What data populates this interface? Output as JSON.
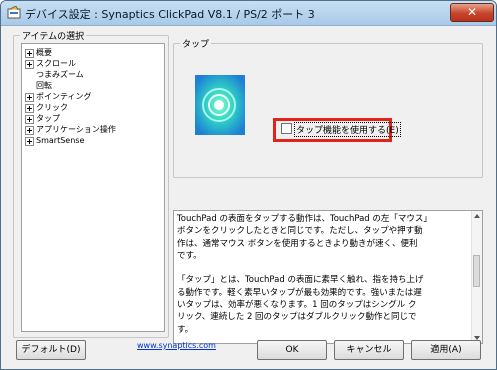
{
  "window": {
    "title": "デバイス設定 : Synaptics ClickPad V8.1 / PS/2 ポート 3",
    "close_glyph": "✕"
  },
  "items_group": {
    "label": "アイテムの選択",
    "tree": [
      {
        "label": "概要",
        "expandable": true
      },
      {
        "label": "スクロール",
        "expandable": true
      },
      {
        "label": "つまみズーム",
        "expandable": false
      },
      {
        "label": "回転",
        "expandable": false
      },
      {
        "label": "ポインティング",
        "expandable": true
      },
      {
        "label": "クリック",
        "expandable": true
      },
      {
        "label": "タップ",
        "expandable": true
      },
      {
        "label": "アプリケーション操作",
        "expandable": true
      },
      {
        "label": "SmartSense",
        "expandable": true
      }
    ]
  },
  "tap_group": {
    "label": "タップ",
    "checkbox_label": "タップ機能を使用する(E)",
    "checkbox_checked": false
  },
  "description": "TouchPad の表面をタップする動作は、TouchPad の左「マウス」\nボタンをクリックしたときと同じです。ただし、タップや押す動\n作は、通常マウス ボタンを使用するときより動きが速く、便利\nです。\n\n「タップ」とは、TouchPad の表面に素早く触れ、指を持ち上げ\nる動作です。軽く素早いタップが最も効果的です。強いまたは遅\nいタップは、効率が悪くなります。1 回のタップはシングル ク\nリック、連続した 2 回のタップはダブルクリック動作と同じで\nす。",
  "footer": {
    "default_button": "デフォルト(D)",
    "link": "www.synaptics.com",
    "ok_button": "OK",
    "cancel_button": "キャンセル",
    "apply_button": "適用(A)"
  },
  "colors": {
    "highlight": "#e2231a",
    "link": "#0033cc"
  }
}
